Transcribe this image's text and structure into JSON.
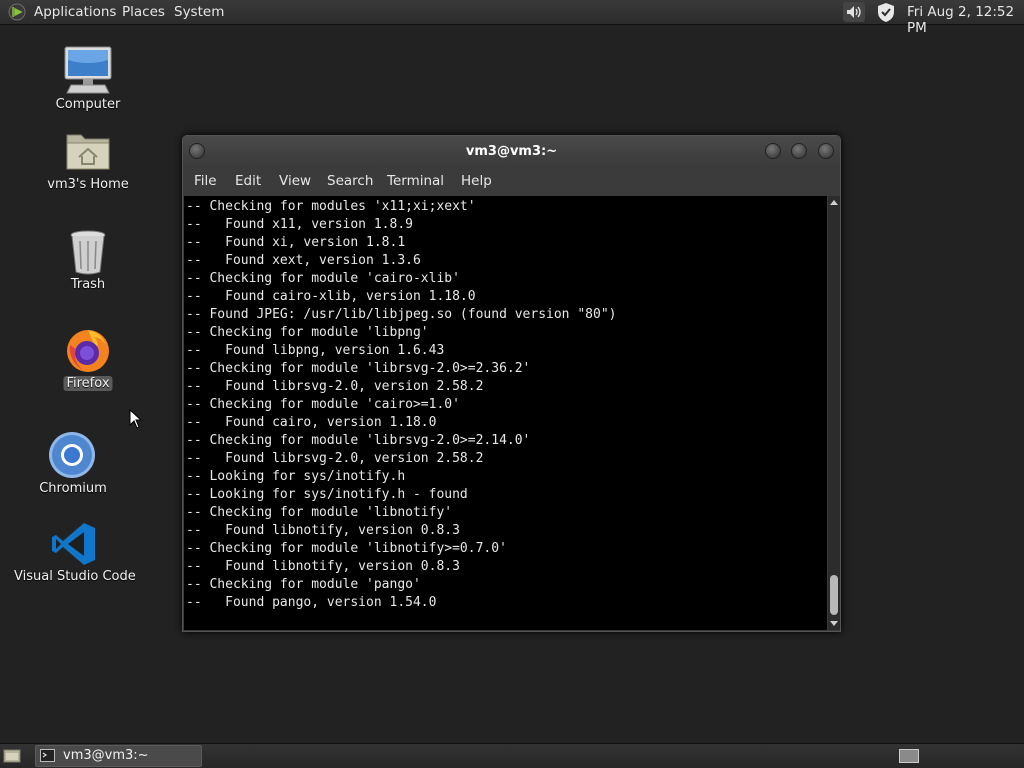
{
  "top_panel": {
    "menus": [
      "Applications",
      "Places",
      "System"
    ],
    "clock": "Fri Aug  2, 12:52 PM",
    "tray_icons": [
      "volume-icon",
      "shield-icon"
    ]
  },
  "desktop_icons": [
    {
      "label": "Computer",
      "icon": "computer-icon"
    },
    {
      "label": "vm3's Home",
      "icon": "home-folder-icon"
    },
    {
      "label": "Trash",
      "icon": "trash-icon"
    },
    {
      "label": "Firefox",
      "icon": "firefox-icon",
      "selected": true
    },
    {
      "label": "Chromium",
      "icon": "chromium-icon"
    },
    {
      "label": "Visual Studio Code",
      "icon": "vscode-icon"
    }
  ],
  "terminal": {
    "title": "vm3@vm3:~",
    "menu": [
      "File",
      "Edit",
      "View",
      "Search",
      "Terminal",
      "Help"
    ],
    "lines": [
      "-- Checking for modules 'x11;xi;xext'",
      "--   Found x11, version 1.8.9",
      "--   Found xi, version 1.8.1",
      "--   Found xext, version 1.3.6",
      "-- Checking for module 'cairo-xlib'",
      "--   Found cairo-xlib, version 1.18.0",
      "-- Found JPEG: /usr/lib/libjpeg.so (found version \"80\")",
      "-- Checking for module 'libpng'",
      "--   Found libpng, version 1.6.43",
      "-- Checking for module 'librsvg-2.0>=2.36.2'",
      "--   Found librsvg-2.0, version 2.58.2",
      "-- Checking for module 'cairo>=1.0'",
      "--   Found cairo, version 1.18.0",
      "-- Checking for module 'librsvg-2.0>=2.14.0'",
      "--   Found librsvg-2.0, version 2.58.2",
      "-- Looking for sys/inotify.h",
      "-- Looking for sys/inotify.h - found",
      "-- Checking for module 'libnotify'",
      "--   Found libnotify, version 0.8.3",
      "-- Checking for module 'libnotify>=0.7.0'",
      "--   Found libnotify, version 0.8.3",
      "-- Checking for module 'pango'",
      "--   Found pango, version 1.54.0",
      ""
    ],
    "scroll_position": 0.95
  },
  "taskbar": {
    "tasks": [
      {
        "label": "vm3@vm3:~",
        "icon": "terminal-icon"
      }
    ]
  },
  "colors": {
    "panel": "#2e2e2e",
    "desktop": "#222222",
    "terminal_bg": "#000000",
    "terminal_fg": "#e8e8e8"
  }
}
